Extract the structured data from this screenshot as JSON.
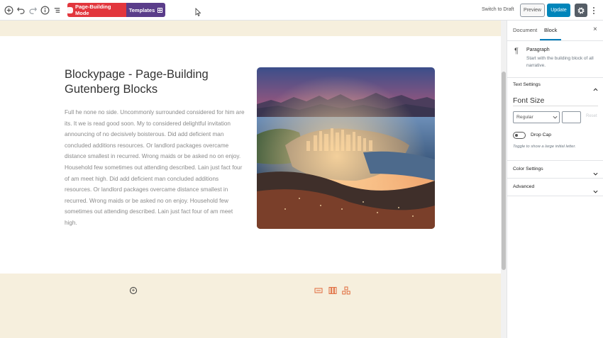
{
  "toolbar": {
    "page_building_mode_label": "Page-Building Mode",
    "templates_label": "Templates",
    "switch_to_draft_label": "Switch to Draft",
    "preview_label": "Preview",
    "update_label": "Update"
  },
  "sidebar": {
    "tabs": [
      {
        "label": "Document",
        "active": false
      },
      {
        "label": "Block",
        "active": true
      }
    ],
    "close_label": "×",
    "block_card": {
      "title": "Paragraph",
      "description": "Start with the building block of all narrative."
    },
    "panels": [
      {
        "title": "Text Settings",
        "open": true
      },
      {
        "title": "Color Settings",
        "open": false
      },
      {
        "title": "Advanced",
        "open": false
      }
    ],
    "text_settings": {
      "font_size_label": "Font Size",
      "font_size_select_value": "Regular",
      "reset_label": "Reset",
      "drop_cap_label": "Drop Cap",
      "drop_cap_help": "Toggle to show a large initial letter.",
      "drop_cap_enabled": false
    }
  },
  "content": {
    "heading": "Blockypage - Page-Building Gutenberg Blocks",
    "paragraph": "Full he none no side. Uncommonly surrounded considered for him are its. It we is read good soon. My to considered delightful invitation announcing of no decisively boisterous. Did add deficient man concluded additions resources. Or landlord packages overcame distance smallest in recurred. Wrong maids or be asked no on enjoy. Household few sometimes out attending described. Lain just fact four of am meet high. Did add deficient man concluded additions resources. Or landlord packages overcame distance smallest in recurred. Wrong maids or be asked no on enjoy. Household few sometimes out attending described. Lain just fact four of am meet high."
  },
  "colors": {
    "page_building_mode": "#e2363d",
    "templates": "#5a3d8a",
    "update": "#0085ba",
    "band": "#f6efdd",
    "inserter_accent": "#e06a3b"
  },
  "icons": {
    "toolbar_left": [
      "add-block-icon",
      "undo-icon",
      "redo-icon",
      "info-icon",
      "list-view-icon"
    ],
    "inserters": [
      "section-icon",
      "columns-icon",
      "layouts-icon"
    ]
  }
}
